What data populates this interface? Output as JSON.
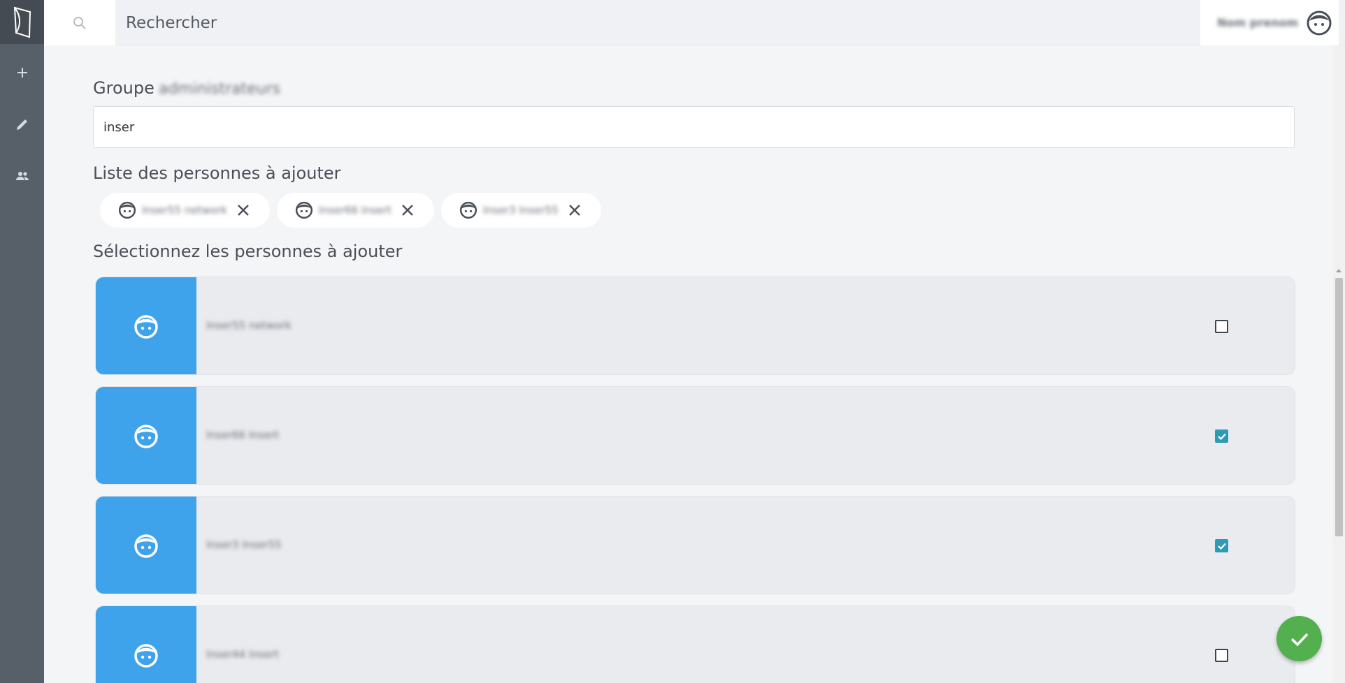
{
  "topbar": {
    "search_placeholder": "Rechercher",
    "user_name": "Nom prenom"
  },
  "group": {
    "label": "Groupe",
    "name": "administrateurs",
    "filter_value": "inser"
  },
  "list_title": "Liste des personnes à ajouter",
  "selected_chips": [
    {
      "name": "Inser55 network"
    },
    {
      "name": "Inser66 Insert"
    },
    {
      "name": "Inser3 Inser55"
    }
  ],
  "select_title": "Sélectionnez les personnes à ajouter",
  "people": [
    {
      "name": "Inser55 network",
      "checked": false
    },
    {
      "name": "Inser66 Insert",
      "checked": true
    },
    {
      "name": "Inser3 Inser55",
      "checked": true
    },
    {
      "name": "Inser44 Insert",
      "checked": false
    }
  ],
  "colors": {
    "sidebar": "#575f68",
    "accent_blue": "#3ea3ea",
    "checkbox_checked": "#2d9bb5",
    "confirm_green": "#52b04f"
  },
  "icons": {
    "sidebar": [
      "logo-icon",
      "plus-icon",
      "pencil-icon",
      "group-icon"
    ],
    "search": "search-icon",
    "avatar": "face-icon",
    "chip_remove": "close-icon",
    "confirm": "check-icon"
  }
}
